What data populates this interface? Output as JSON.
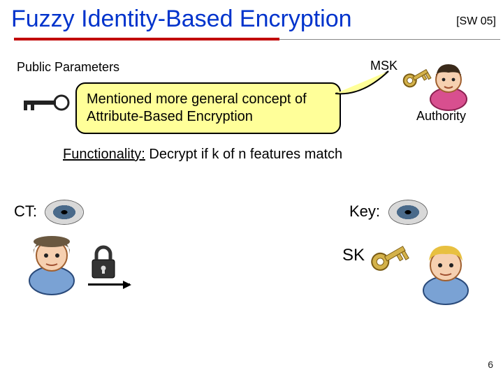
{
  "title": "Fuzzy Identity-Based Encryption",
  "cite": "[SW 05]",
  "pubparams": "Public Parameters",
  "msk": "MSK",
  "callout": "Mentioned more general concept of Attribute-Based Encryption",
  "authority": "Authority",
  "functionality_label": "Functionality:",
  "functionality_rest": " Decrypt if k of n features match",
  "ct": "CT:",
  "keylabel": "Key:",
  "sk": "SK",
  "page": "6",
  "colors": {
    "title": "#0033cc",
    "underline": "#c10000",
    "callout_bg": "#ffff99"
  }
}
